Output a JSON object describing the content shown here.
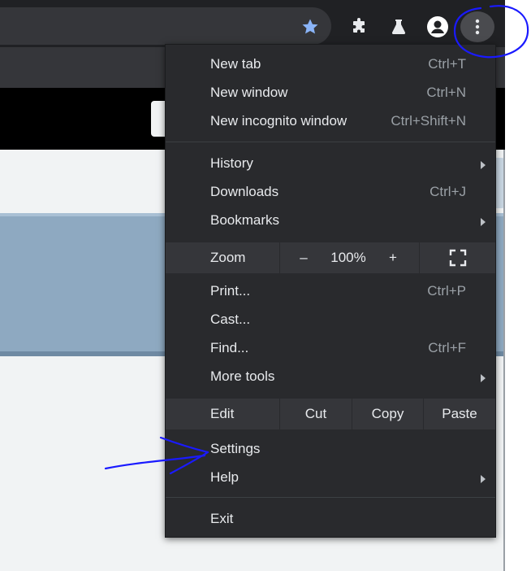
{
  "menu": {
    "group1": [
      {
        "label": "New tab",
        "shortcut": "Ctrl+T"
      },
      {
        "label": "New window",
        "shortcut": "Ctrl+N"
      },
      {
        "label": "New incognito window",
        "shortcut": "Ctrl+Shift+N"
      }
    ],
    "group2": [
      {
        "label": "History",
        "shortcut": ""
      },
      {
        "label": "Downloads",
        "shortcut": "Ctrl+J"
      },
      {
        "label": "Bookmarks",
        "shortcut": ""
      }
    ],
    "zoom": {
      "label": "Zoom",
      "minus": "–",
      "value": "100%",
      "plus": "+"
    },
    "group3": [
      {
        "label": "Print...",
        "shortcut": "Ctrl+P"
      },
      {
        "label": "Cast...",
        "shortcut": ""
      },
      {
        "label": "Find...",
        "shortcut": "Ctrl+F"
      },
      {
        "label": "More tools",
        "shortcut": ""
      }
    ],
    "edit": {
      "label": "Edit",
      "cut": "Cut",
      "copy": "Copy",
      "paste": "Paste"
    },
    "group4": [
      {
        "label": "Settings",
        "shortcut": ""
      },
      {
        "label": "Help",
        "shortcut": ""
      }
    ],
    "exit": {
      "label": "Exit"
    }
  },
  "colors": {
    "menu_bg": "#292a2d",
    "row_bg": "#35363a",
    "text": "#e8eaed",
    "shortcut": "#9aa0a6",
    "star": "#8ab4f8",
    "annotation": "#1a1aff"
  },
  "icons": {
    "star": "bookmark-star-icon",
    "extensions": "puzzle-piece-icon",
    "labs": "flask-icon",
    "profile": "profile-avatar-icon",
    "menu": "three-dot-menu-icon",
    "fullscreen": "fullscreen-icon"
  }
}
